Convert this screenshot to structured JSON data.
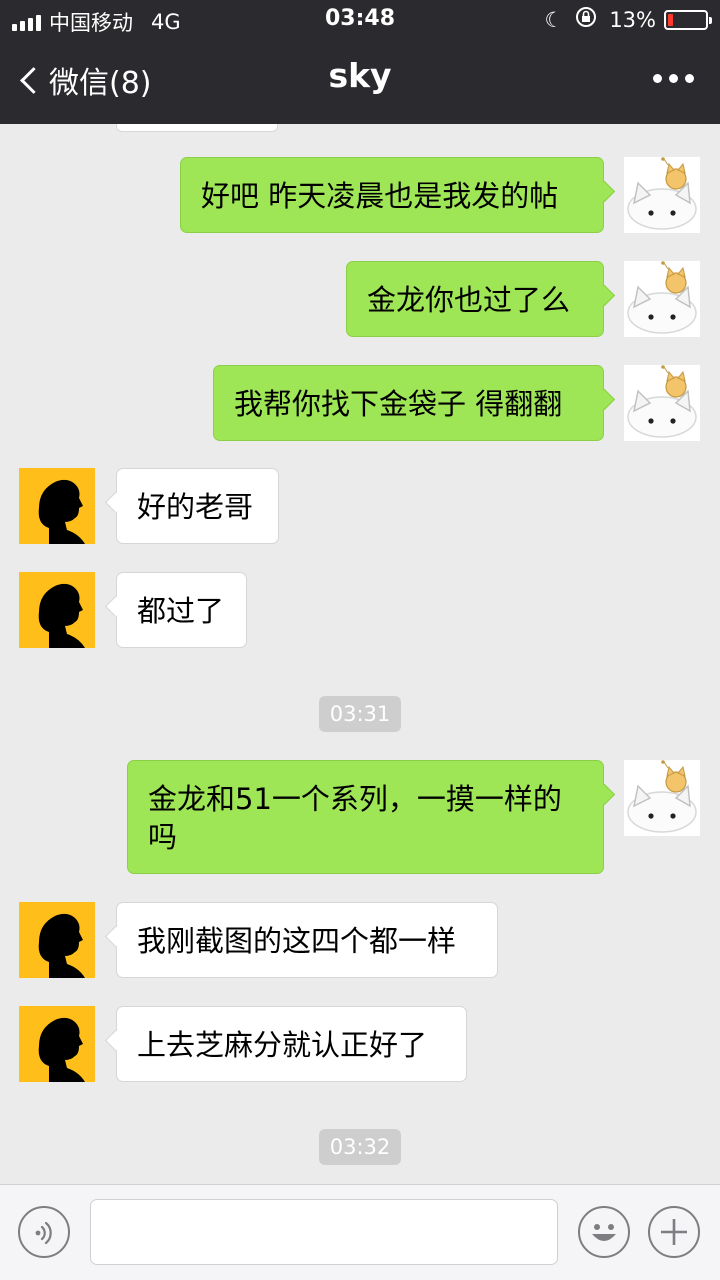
{
  "status_bar": {
    "carrier": "中国移动",
    "network": "4G",
    "time": "03:48",
    "battery_percent": "13%",
    "battery_level": 0.13,
    "battery_color": "#ff3b30"
  },
  "nav": {
    "back_label": "微信(8)",
    "title": "sky"
  },
  "colors": {
    "header_bg": "#2b2b2f",
    "chat_bg": "#ebebeb",
    "sent_bubble": "#9fe657",
    "received_bubble": "#ffffff",
    "timestamp_bg": "#cecece",
    "contact_avatar_bg": "#ffbe1a"
  },
  "messages": [
    {
      "side": "sent",
      "text": "好吧 昨天凌晨也是我发的帖"
    },
    {
      "side": "sent",
      "text": "金龙你也过了么"
    },
    {
      "side": "sent",
      "text": "我帮你找下金袋子 得翻翻"
    },
    {
      "side": "received",
      "text": "好的老哥"
    },
    {
      "side": "received",
      "text": "都过了"
    },
    {
      "side": "time",
      "text": "03:31"
    },
    {
      "side": "sent",
      "text": "金龙和51一个系列，一摸一样的吗"
    },
    {
      "side": "received",
      "text": "我刚截图的这四个都一样"
    },
    {
      "side": "received",
      "text": "上去芝麻分就认正好了"
    },
    {
      "side": "time",
      "text": "03:32"
    }
  ],
  "input_bar": {
    "text_value": "",
    "icons": [
      "voice-icon",
      "emoji-icon",
      "plus-icon"
    ]
  }
}
